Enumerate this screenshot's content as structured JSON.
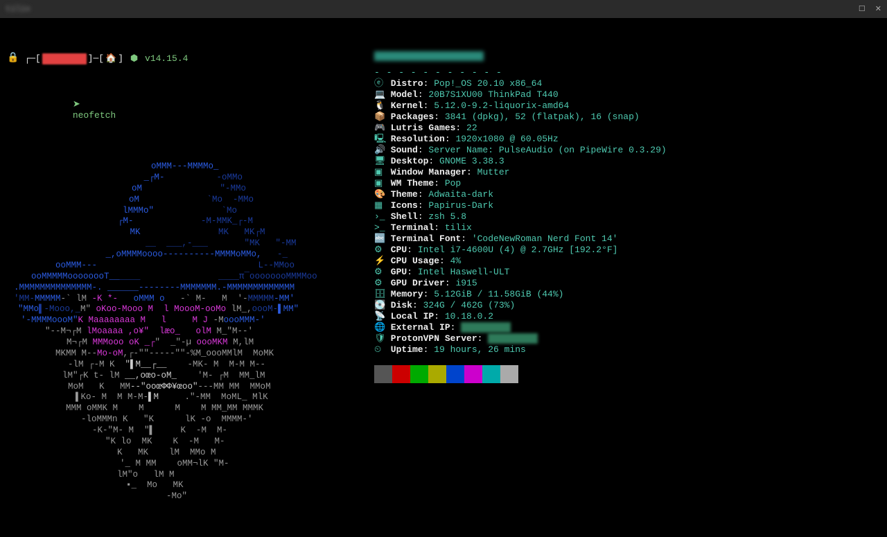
{
  "titlebar": {
    "title": "tilix"
  },
  "prompt": {
    "user_redacted": "████",
    "node_version": "v14.15.4",
    "command": "neofetch"
  },
  "info": {
    "Distro": "Pop!_OS 20.10 x86_64",
    "Model": "20B7S1XU00 ThinkPad T440",
    "Kernel": "5.12.0-9.2-liquorix-amd64",
    "Packages": "3841 (dpkg), 52 (flatpak), 16 (snap)",
    "Lutris Games": "22",
    "Resolution": "1920x1080 @ 60.05Hz",
    "Sound": "Server Name: PulseAudio (on PipeWire 0.3.29)",
    "Desktop": "GNOME 3.38.3",
    "Window Manager": "Mutter",
    "WM Theme": "Pop",
    "Theme": "Adwaita-dark",
    "Icons": "Papirus-Dark",
    "Shell": "zsh 5.8",
    "Terminal": "tilix",
    "Terminal Font": "'CodeNewRoman Nerd Font 14'",
    "CPU": "Intel i7-4600U (4) @ 2.7GHz [192.2°F]",
    "CPU Usage": "4%",
    "GPU": "Intel Haswell-ULT",
    "GPU Driver": "i915",
    "Memory": "5.12GiB / 11.58GiB (44%)",
    "Disk": "324G / 462G (73%)",
    "Local IP": "10.18.0.2",
    "External IP": "████",
    "ProtonVPN Server": "████",
    "Uptime": "19 hours, 26 mins"
  },
  "icons": {
    "Distro": "ⓔ",
    "Model": "💻",
    "Kernel": "🐧",
    "Packages": "📦",
    "Lutris Games": "🎮",
    "Resolution": "🖳",
    "Sound": "🔊",
    "Desktop": "🖥",
    "Window Manager": "▣",
    "WM Theme": "▣",
    "Theme": "🎨",
    "Icons": "▦",
    "Shell": "›_",
    "Terminal": ">_",
    "Terminal Font": "🔤",
    "CPU": "⚙",
    "CPU Usage": "⚡",
    "GPU": "⚙",
    "GPU Driver": "⚙",
    "Memory": "🗄",
    "Disk": "💽",
    "Local IP": "📡",
    "External IP": "🌐",
    "ProtonVPN Server": "🛡",
    "Uptime": "⏲"
  },
  "colors": [
    "#555",
    "#cc0000",
    "#00aa00",
    "#aaaa00",
    "#0044cc",
    "#cc00cc",
    "#00aaaa",
    "#aaaaaa"
  ],
  "ascii": [
    {
      "pad": 208,
      "spans": [
        [
          "b",
          "oMMM---MMMMo_"
        ]
      ]
    },
    {
      "pad": 190,
      "spans": [
        [
          "b",
          " _┌M-"
        ],
        [
          "db",
          "          -oMMo"
        ]
      ]
    },
    {
      "pad": 180,
      "spans": [
        [
          "b",
          "oM"
        ],
        [
          "db",
          "               \"-MMo"
        ]
      ]
    },
    {
      "pad": 176,
      "spans": [
        [
          "b",
          "oM"
        ],
        [
          "db",
          "             `Mo  -MMo"
        ]
      ]
    },
    {
      "pad": 167,
      "spans": [
        [
          "b",
          "lMMMo\""
        ],
        [
          "db",
          "             `Mo"
        ]
      ]
    },
    {
      "pad": 160,
      "spans": [
        [
          "b",
          "┌M-"
        ],
        [
          "db",
          "             -M-MMK_┌-M"
        ]
      ]
    },
    {
      "pad": 155,
      "spans": [
        [
          "b",
          "   MK"
        ],
        [
          "db",
          "               MK   MK┌M"
        ]
      ]
    },
    {
      "pad": 140,
      "spans": [
        [
          "db",
          "        __  ___,-___       \"MK   \"-MM"
        ]
      ]
    },
    {
      "pad": 90,
      "spans": [
        [
          "b",
          "       _,oMMMMoooo----------MMMMoMMo,"
        ],
        [
          "db",
          "   -_"
        ]
      ]
    },
    {
      "pad": 55,
      "spans": [
        [
          "b",
          "  ooMMM---"
        ],
        [
          "db",
          "                               L--MMoo"
        ]
      ]
    },
    {
      "pad": 35,
      "spans": [
        [
          "b",
          "ooMMMMMoooooooT__"
        ],
        [
          "db",
          "____               ____π‾oooooooMMMMoo"
        ]
      ]
    },
    {
      "pad": 10,
      "spans": [
        [
          "b",
          ".MMMMMMMMMMMMMM-. ______--------MMMMMMM.-MMMMMMMMMMMMM"
        ]
      ]
    },
    {
      "pad": 10,
      "spans": [
        [
          "db",
          "'MM-"
        ],
        [
          "b",
          "MMMMM"
        ],
        [
          "g",
          "-` lM "
        ],
        [
          "m",
          "-K *-   "
        ],
        [
          "b",
          "oMMM o"
        ],
        [
          "g",
          "   -` M-   M  '-"
        ],
        [
          "db",
          "MMMMM"
        ],
        [
          "b",
          "-MM'"
        ]
      ]
    },
    {
      "pad": 16,
      "spans": [
        [
          "b",
          "\"MMo"
        ],
        [
          "db",
          "▌-Mooo,_"
        ],
        [
          "g",
          "M\" "
        ],
        [
          "m",
          "oKoo-Mooo M  l MoooM-ooMo"
        ],
        [
          "g",
          " lM_,"
        ],
        [
          "db",
          "oooM-"
        ],
        [
          "b",
          "▌MM\""
        ]
      ]
    },
    {
      "pad": 20,
      "spans": [
        [
          "b",
          "'-MMMMoooM\""
        ],
        [
          "m",
          "K Maaaaaaaa M   l     M J "
        ],
        [
          "g",
          "-M"
        ],
        [
          "b",
          "oooMMM-'"
        ]
      ]
    },
    {
      "pad": 55,
      "spans": [
        [
          "g",
          "\"--M¬┌M "
        ],
        [
          "m",
          "lMoaaaa ,o¥\"  læo_   olM"
        ],
        [
          "g",
          " M_\"M--'"
        ]
      ]
    },
    {
      "pad": 86,
      "spans": [
        [
          "g",
          "M¬┌M "
        ],
        [
          "m",
          "MMMooo oK _┌"
        ],
        [
          "g",
          "\"  _\"-µ "
        ],
        [
          "m",
          "oooMKM"
        ],
        [
          "g",
          " M,lM"
        ]
      ]
    },
    {
      "pad": 70,
      "spans": [
        [
          "g",
          "MKMM M--"
        ],
        [
          "m",
          "Mo-oM"
        ],
        [
          "g",
          ",┌-\"\"-----\"\"-%M_oooMMlM  MoMK"
        ]
      ]
    },
    {
      "pad": 88,
      "spans": [
        [
          "g",
          "-lM ┌-M K"
        ],
        [
          "w",
          "  \"▌M__┌__"
        ],
        [
          "g",
          "    -MK- M  M-M M--"
        ]
      ]
    },
    {
      "pad": 80,
      "spans": [
        [
          "g",
          "lM\"┌K t- lM"
        ],
        [
          "w",
          " __,oœo-oM_"
        ],
        [
          "g",
          "    'M- ┌M  MM_lM"
        ]
      ]
    },
    {
      "pad": 88,
      "spans": [
        [
          "g",
          "MoM   K   MM"
        ],
        [
          "w",
          "--\"ooœΦΦ¥œoo\""
        ],
        [
          "g",
          "---MM MM  MMoM"
        ]
      ]
    },
    {
      "pad": 99,
      "spans": [
        [
          "g",
          "▌Ko- M  M M-M-"
        ],
        [
          "w",
          "▌M"
        ],
        [
          "g",
          "     .\"-MM  MoML_ MlK"
        ]
      ]
    },
    {
      "pad": 85,
      "spans": [
        [
          "g",
          "MMM oMMK M    M      M    M MM_MM MMMK"
        ]
      ]
    },
    {
      "pad": 107,
      "spans": [
        [
          "g",
          "-loMMMn K   \"K      lK -o  MMMM-'"
        ]
      ]
    },
    {
      "pad": 123,
      "spans": [
        [
          "g",
          "-K-\"M- M  \"▌     K  -M  M-"
        ]
      ]
    },
    {
      "pad": 142,
      "spans": [
        [
          "g",
          "\"K lo  MK    K  -M   M-"
        ]
      ]
    },
    {
      "pad": 159,
      "spans": [
        [
          "g",
          "K   MK    lM  MMo M"
        ]
      ]
    },
    {
      "pad": 163,
      "spans": [
        [
          "g",
          "'_ M MM    oMM¬lK \"M-"
        ]
      ]
    },
    {
      "pad": 159,
      "spans": [
        [
          "g",
          "lM\"o   lM M"
        ]
      ]
    },
    {
      "pad": 172,
      "spans": [
        [
          "g",
          "▪_  Mo   MK"
        ]
      ]
    },
    {
      "pad": 230,
      "spans": [
        [
          "g",
          "-Mo\""
        ]
      ]
    }
  ]
}
